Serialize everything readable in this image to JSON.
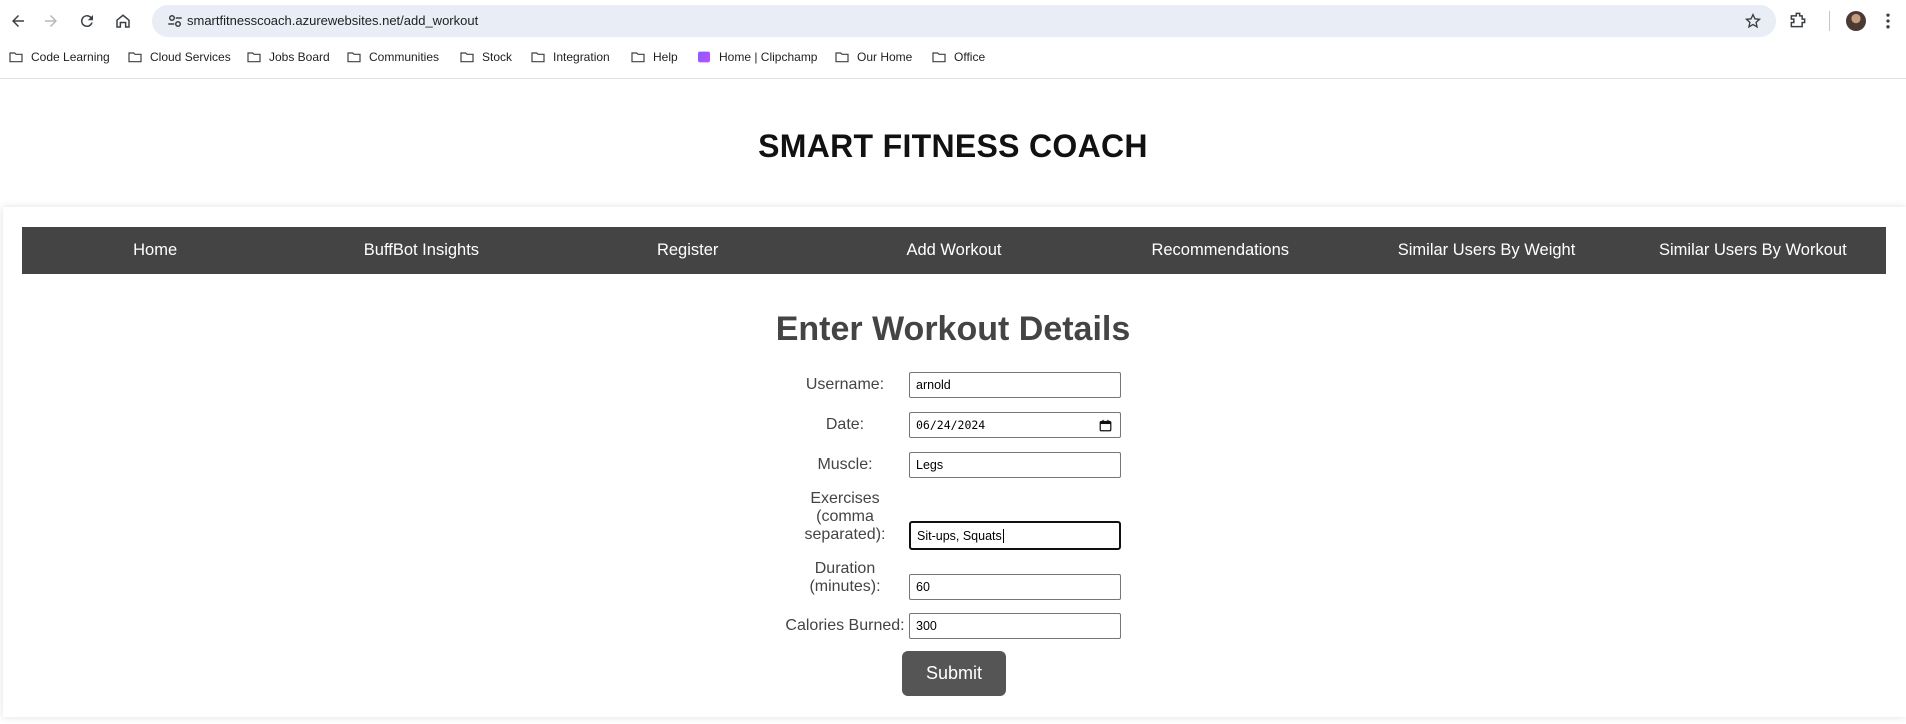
{
  "browser": {
    "url": "smartfitnesscoach.azurewebsites.net/add_workout",
    "bookmarks": [
      "Code Learning",
      "Cloud Services",
      "Jobs Board",
      "Communities",
      "Stock",
      "Integration",
      "Help",
      "Home | Clipchamp",
      "Our Home",
      "Office"
    ]
  },
  "site": {
    "title": "SMART FITNESS COACH",
    "nav": [
      "Home",
      "BuffBot Insights",
      "Register",
      "Add Workout",
      "Recommendations",
      "Similar Users By Weight",
      "Similar Users By Workout"
    ]
  },
  "form": {
    "title": "Enter Workout Details",
    "fields": {
      "username": {
        "label": "Username:",
        "value": "arnold"
      },
      "date": {
        "label": "Date:",
        "value": "06/24/2024"
      },
      "muscle": {
        "label": "Muscle:",
        "value": "Legs"
      },
      "exercises": {
        "label_line1": "Exercises",
        "label_line2": "(comma",
        "label_line3": "separated):",
        "value": "Sit-ups, Squats"
      },
      "duration": {
        "label_line1": "Duration",
        "label_line2": "(minutes):",
        "value": "60"
      },
      "calories": {
        "label": "Calories Burned:",
        "value": "300"
      }
    },
    "submit_label": "Submit"
  },
  "colors": {
    "navbar_bg": "#444444",
    "submit_bg": "#555555",
    "omnibox_bg": "#e9edf6"
  },
  "icons": [
    "back-arrow-icon",
    "forward-arrow-icon",
    "reload-icon",
    "home-icon",
    "site-settings-icon",
    "bookmark-star-icon",
    "extensions-icon",
    "profile-avatar",
    "menu-dots-icon",
    "folder-icon",
    "clipchamp-icon",
    "calendar-icon"
  ]
}
